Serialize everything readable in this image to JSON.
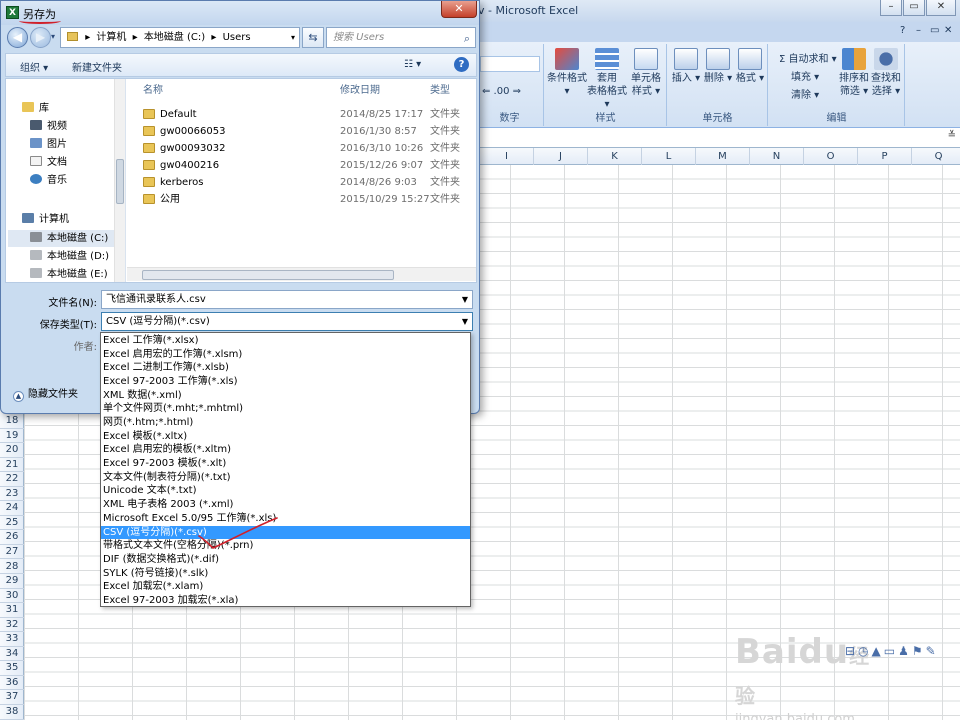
{
  "excel": {
    "title": "Microsoft Excel",
    "title_prefix": "v - ",
    "window_buttons": [
      "–",
      "▭",
      "✕"
    ],
    "ribbon_groups": [
      {
        "label": "数字",
        "buttons": []
      },
      {
        "label": "样式",
        "buttons": [
          "条件格式",
          "套用\n表格格式",
          "单元格\n样式"
        ]
      },
      {
        "label": "单元格",
        "buttons": [
          "插入",
          "删除",
          "格式"
        ]
      },
      {
        "label": "编辑",
        "buttons": [
          "排序和\n筛选",
          "查找和\n选择"
        ]
      }
    ],
    "edit_small": [
      "Σ 自动求和 ▾",
      "填充 ▾",
      "清除 ▾"
    ],
    "columns": [
      "I",
      "J",
      "K",
      "L",
      "M",
      "N",
      "O",
      "P",
      "Q"
    ],
    "rows": [
      "18",
      "19",
      "20",
      "21",
      "22",
      "23",
      "24",
      "25",
      "26",
      "27",
      "28",
      "29",
      "30",
      "31",
      "32",
      "33",
      "34",
      "35",
      "36",
      "37",
      "38"
    ],
    "watermark": {
      "brand": "Baidu",
      "suffix": "经验",
      "url": "jingyan.baidu.com"
    }
  },
  "dialog": {
    "title": "另存为",
    "close_label": "✕",
    "address": [
      "计算机",
      "本地磁盘 (C:)",
      "Users"
    ],
    "search_placeholder": "搜索 Users",
    "toolbar": {
      "organize": "组织 ▾",
      "new_folder": "新建文件夹",
      "view": "☷ ▾"
    },
    "nav_items": [
      {
        "label": "库",
        "type": "group"
      },
      {
        "label": "视频",
        "type": "item"
      },
      {
        "label": "图片",
        "type": "item"
      },
      {
        "label": "文档",
        "type": "item"
      },
      {
        "label": "音乐",
        "type": "item"
      },
      {
        "label": "计算机",
        "type": "group"
      },
      {
        "label": "本地磁盘 (C:)",
        "type": "drive",
        "selected": true
      },
      {
        "label": "本地磁盘 (D:)",
        "type": "drive"
      },
      {
        "label": "本地磁盘 (E:)",
        "type": "drive"
      }
    ],
    "file_headers": {
      "name": "名称",
      "date": "修改日期",
      "type": "类型"
    },
    "files": [
      {
        "name": "Default",
        "date": "2014/8/25 17:17",
        "type": "文件夹"
      },
      {
        "name": "gw00066053",
        "date": "2016/1/30 8:57",
        "type": "文件夹"
      },
      {
        "name": "gw00093032",
        "date": "2016/3/10 10:26",
        "type": "文件夹"
      },
      {
        "name": "gw0400216",
        "date": "2015/12/26 9:07",
        "type": "文件夹"
      },
      {
        "name": "kerberos",
        "date": "2014/8/26 9:03",
        "type": "文件夹"
      },
      {
        "name": "公用",
        "date": "2015/10/29 15:27",
        "type": "文件夹"
      }
    ],
    "filename_label": "文件名(N):",
    "filename_value": "飞信通讯录联系人.csv",
    "filetype_label": "保存类型(T):",
    "filetype_value": "CSV (逗号分隔)(*.csv)",
    "author_label": "作者:",
    "hide_folders": "隐藏文件夹",
    "type_options": [
      "Excel 工作簿(*.xlsx)",
      "Excel 启用宏的工作簿(*.xlsm)",
      "Excel 二进制工作簿(*.xlsb)",
      "Excel 97-2003 工作簿(*.xls)",
      "XML 数据(*.xml)",
      "单个文件网页(*.mht;*.mhtml)",
      "网页(*.htm;*.html)",
      "Excel 模板(*.xltx)",
      "Excel 启用宏的模板(*.xltm)",
      "Excel 97-2003 模板(*.xlt)",
      "文本文件(制表符分隔)(*.txt)",
      "Unicode 文本(*.txt)",
      "XML 电子表格 2003 (*.xml)",
      "Microsoft Excel 5.0/95 工作簿(*.xls)",
      "CSV (逗号分隔)(*.csv)",
      "带格式文本文件(空格分隔)(*.prn)",
      "DIF (数据交换格式)(*.dif)",
      "SYLK (符号链接)(*.slk)",
      "Excel 加载宏(*.xlam)",
      "Excel 97-2003 加载宏(*.xla)"
    ],
    "selected_option": 14
  },
  "colors": {
    "selection": "#3399ff",
    "annotation": "#d0202a"
  }
}
